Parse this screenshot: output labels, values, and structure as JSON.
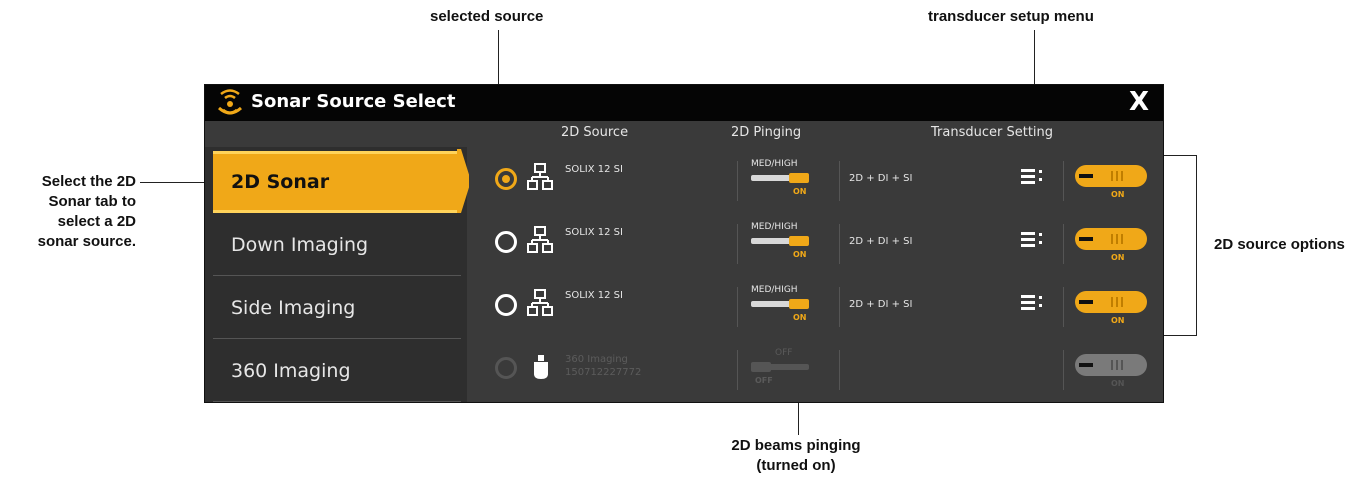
{
  "callouts": {
    "selected_source": "selected source",
    "transducer_menu": "transducer setup menu",
    "sonar_tab": [
      "Select the 2D",
      "Sonar tab to",
      "select a 2D",
      "sonar source."
    ],
    "source_options": "2D source options",
    "beams_pinging": [
      "2D beams pinging",
      "(turned on)"
    ]
  },
  "window": {
    "title": "Sonar Source Select",
    "close_label": "X",
    "headers": {
      "source": "2D Source",
      "pinging": "2D Pinging",
      "transducer": "Transducer Setting"
    }
  },
  "tabs": [
    "2D Sonar",
    "Down Imaging",
    "Side Imaging",
    "360 Imaging"
  ],
  "rows": [
    {
      "selected": true,
      "source": "SOLIX 12 SI",
      "ping_mode": "MED/HIGH",
      "ping_state": "ON",
      "transducer": "2D + DI + SI",
      "toggle": "ON"
    },
    {
      "selected": false,
      "source": "SOLIX 12 SI",
      "ping_mode": "MED/HIGH",
      "ping_state": "ON",
      "transducer": "2D + DI + SI",
      "toggle": "ON"
    },
    {
      "selected": false,
      "source": "SOLIX 12 SI",
      "ping_mode": "MED/HIGH",
      "ping_state": "ON",
      "transducer": "2D + DI + SI",
      "toggle": "ON"
    },
    {
      "selected": false,
      "disabled": true,
      "source_line1": "360 Imaging",
      "source_line2": "150712227772",
      "ping_mode": "OFF",
      "ping_state": "OFF",
      "toggle": "ON"
    }
  ],
  "colors": {
    "accent": "#f0a818",
    "panel": "#3a3a3a",
    "titlebar": "#050505"
  }
}
